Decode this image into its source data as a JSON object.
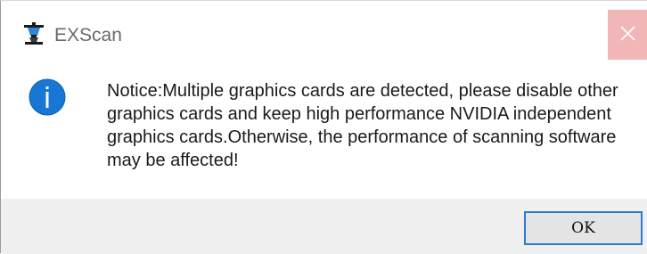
{
  "window": {
    "title": "EXScan",
    "app_icon": "exscan-scanner-icon",
    "close_icon": "close-icon"
  },
  "dialog": {
    "icon": "info-icon",
    "message": "Notice:Multiple graphics cards are detected, please disable other graphics cards and keep high performance NVIDIA independent graphics cards.Otherwise, the performance of scanning software may be affected!"
  },
  "buttons": {
    "ok_label": "OK"
  },
  "colors": {
    "info_blue": "#1877d4",
    "close_hover": "#f2b6b8",
    "footer_bg": "#f0f0f0",
    "focus_border": "#2f7ad1"
  }
}
